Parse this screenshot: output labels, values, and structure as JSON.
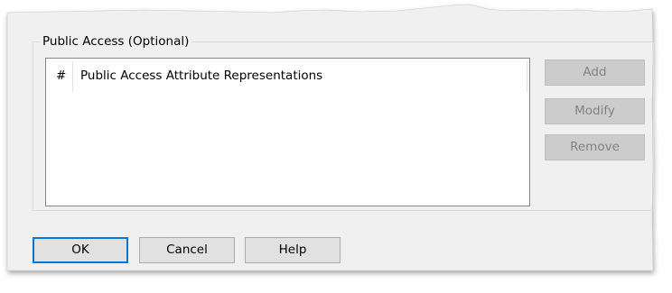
{
  "groupbox": {
    "label": "Public Access (Optional)"
  },
  "listview": {
    "columns": [
      "#",
      "Public Access Attribute Representations"
    ],
    "rows": []
  },
  "side_buttons": {
    "add": "Add",
    "modify": "Modify",
    "remove": "Remove"
  },
  "footer_buttons": {
    "ok": "OK",
    "cancel": "Cancel",
    "help": "Help"
  },
  "colors": {
    "dialog_bg": "#f0f0f0",
    "default_button_border": "#0078d7",
    "disabled_text": "#838383"
  }
}
